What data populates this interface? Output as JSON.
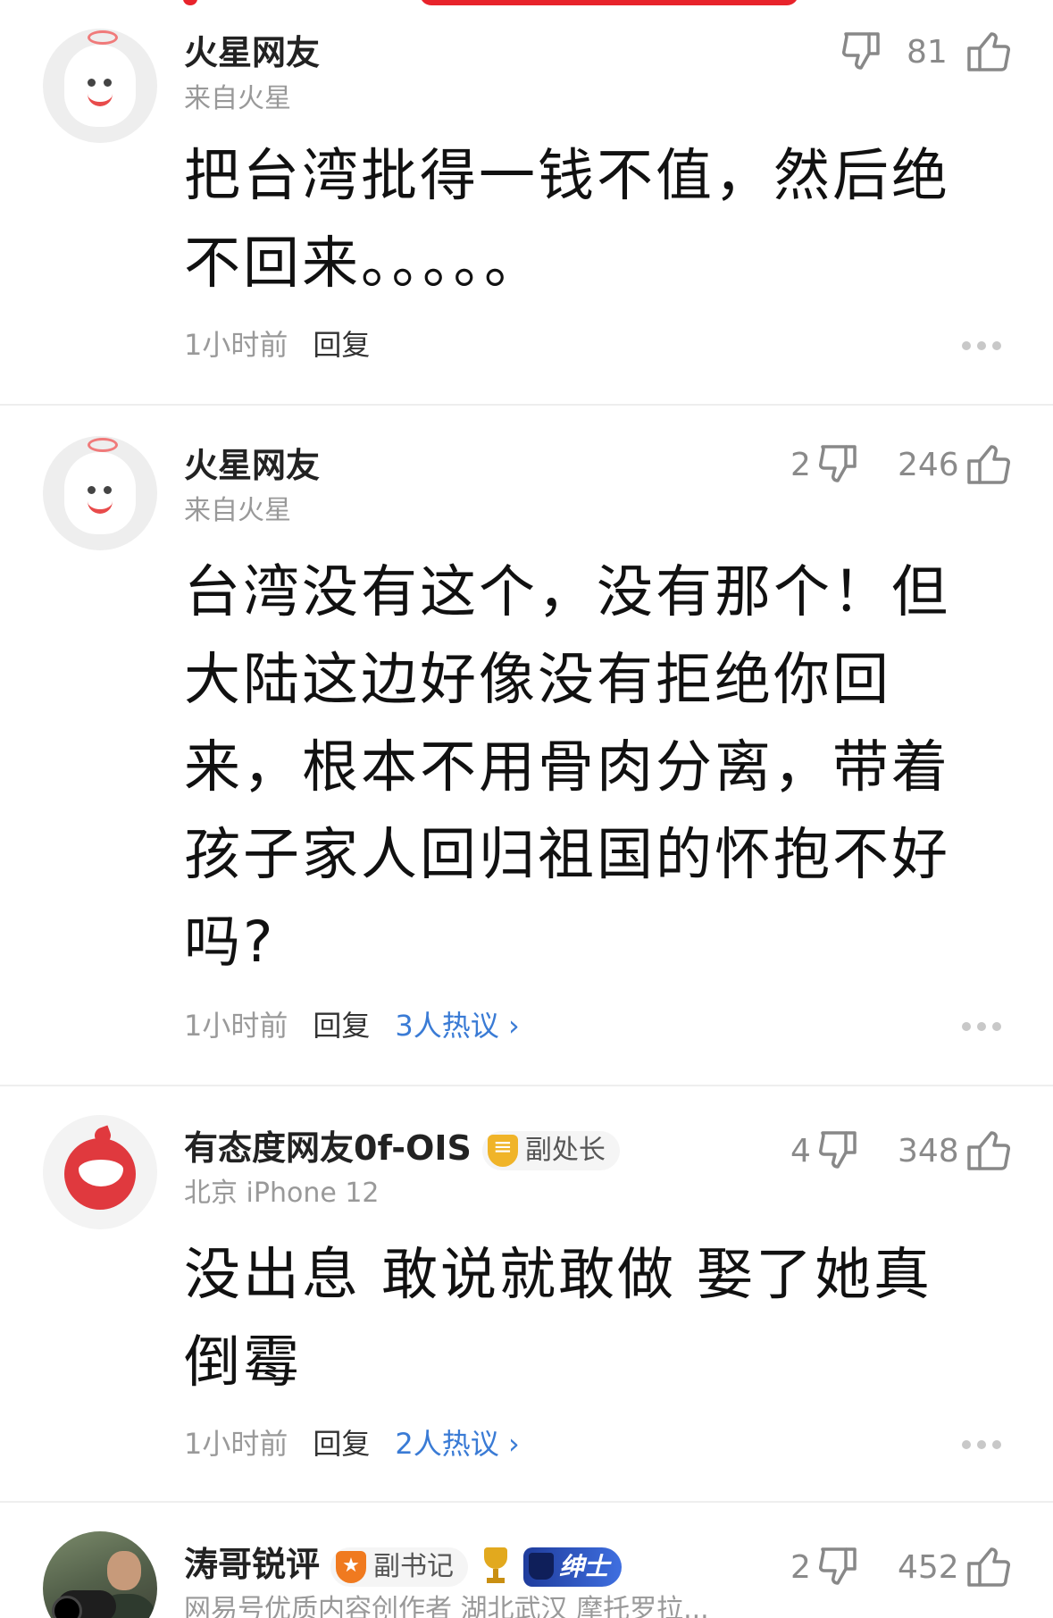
{
  "comments": [
    {
      "user": "火星网友",
      "sub": "来自火星",
      "down_count": "",
      "up_count": "81",
      "text": "把台湾批得一钱不值，然后绝不回来。。。。。",
      "time": "1小时前",
      "reply": "回复",
      "hot": ""
    },
    {
      "user": "火星网友",
      "sub": "来自火星",
      "down_count": "2",
      "up_count": "246",
      "text": "台湾没有这个，没有那个！但大陆这边好像没有拒绝你回来，根本不用骨肉分离，带着孩子家人回归祖国的怀抱不好吗?",
      "time": "1小时前",
      "reply": "回复",
      "hot": "3人热议"
    },
    {
      "user": "有态度网友0f-OIS",
      "badge": "副处长",
      "sub": "北京  iPhone 12",
      "down_count": "4",
      "up_count": "348",
      "text": "没出息 敢说就敢做 娶了她真倒霉",
      "time": "1小时前",
      "reply": "回复",
      "hot": "2人热议"
    },
    {
      "user": "涛哥锐评",
      "badge": "副书记",
      "badge2": "绅士",
      "sub": "网易号优质内容创作者  湖北武汉  摩托罗拉...",
      "down_count": "2",
      "up_count": "452"
    }
  ],
  "icons": {
    "thumb_up": "thumb-up-icon",
    "thumb_down": "thumb-down-icon",
    "more": "more-dots-icon",
    "chevron": "chevron-right-icon"
  },
  "colors": {
    "accent_red": "#e8232b",
    "link_blue": "#3a7bd5"
  }
}
